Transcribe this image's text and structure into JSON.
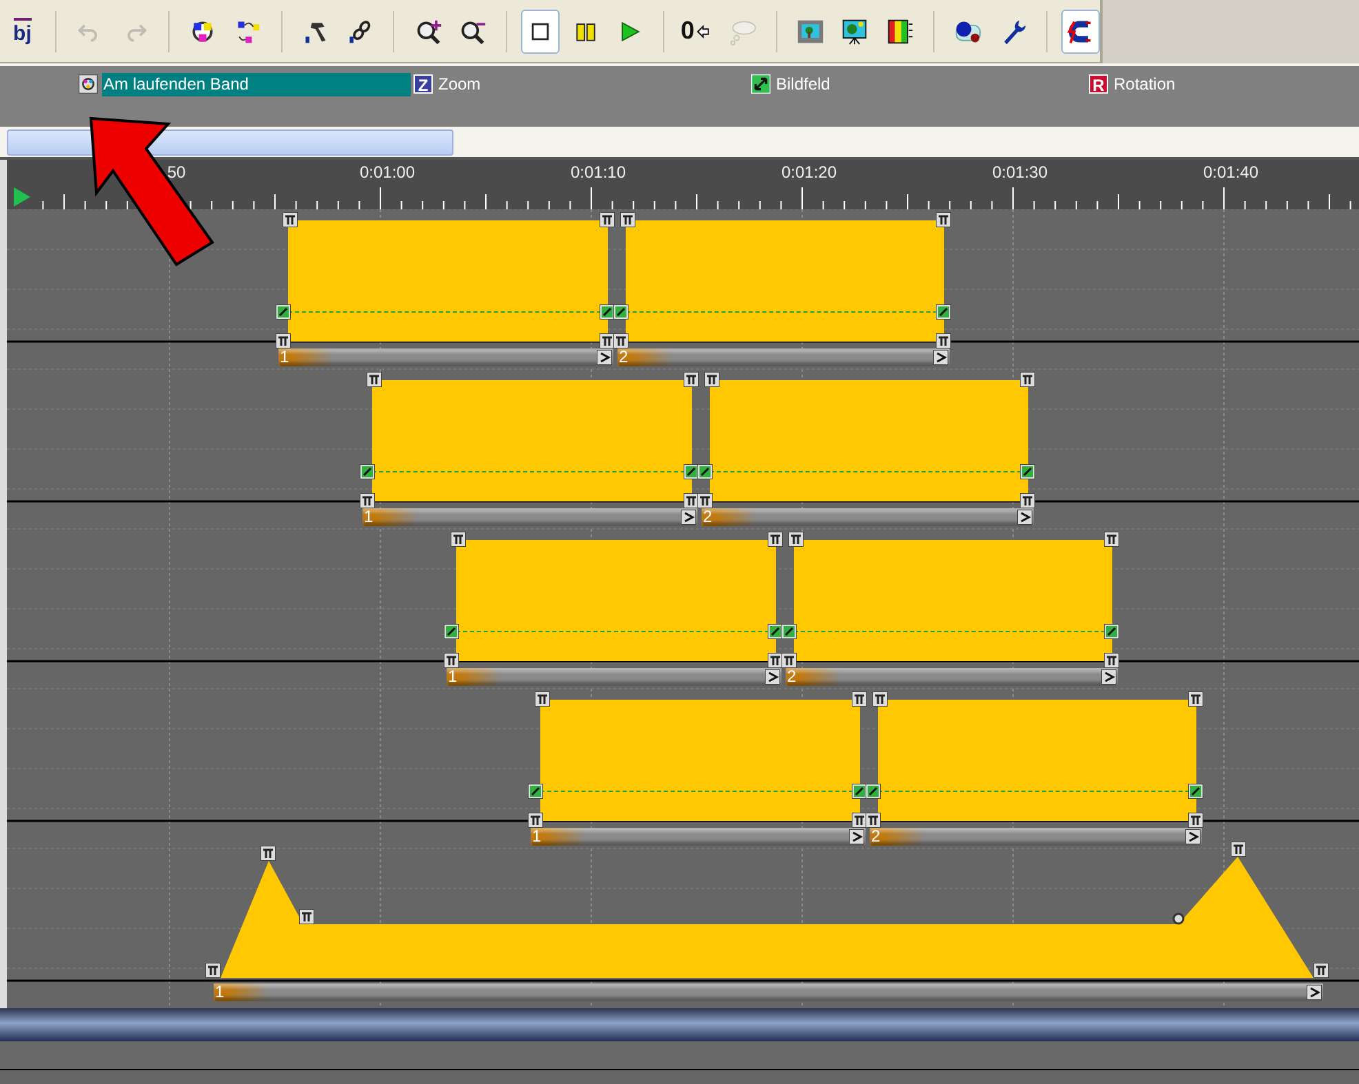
{
  "toolbar_groups": [
    [
      {
        "kind": "obj",
        "label": "bj",
        "pressed": false,
        "disabled": false
      }
    ],
    [
      {
        "kind": "undo",
        "pressed": false,
        "disabled": true
      },
      {
        "kind": "redo",
        "pressed": false,
        "disabled": true
      }
    ],
    [
      {
        "kind": "color-ring",
        "pressed": false,
        "disabled": false
      },
      {
        "kind": "color-path",
        "pressed": false,
        "disabled": false
      }
    ],
    [
      {
        "kind": "hammer",
        "pressed": false,
        "disabled": false
      },
      {
        "kind": "chain",
        "pressed": false,
        "disabled": false
      }
    ],
    [
      {
        "kind": "zoom-in",
        "pressed": false,
        "disabled": false
      },
      {
        "kind": "zoom-out",
        "pressed": false,
        "disabled": false
      }
    ],
    [
      {
        "kind": "stop",
        "pressed": true,
        "disabled": false
      },
      {
        "kind": "pause",
        "pressed": false,
        "disabled": false
      },
      {
        "kind": "play",
        "pressed": false,
        "disabled": false
      }
    ],
    [
      {
        "kind": "rewind",
        "label": "0",
        "pressed": false,
        "disabled": false
      },
      {
        "kind": "sleep",
        "pressed": false,
        "disabled": true
      }
    ],
    [
      {
        "kind": "picture",
        "pressed": false,
        "disabled": false
      },
      {
        "kind": "presentation",
        "pressed": false,
        "disabled": false
      },
      {
        "kind": "meter",
        "pressed": false,
        "disabled": false
      }
    ],
    [
      {
        "kind": "dots",
        "pressed": false,
        "disabled": false
      },
      {
        "kind": "wrench",
        "pressed": false,
        "disabled": false
      }
    ],
    [
      {
        "kind": "magnet",
        "pressed": true,
        "disabled": false
      }
    ]
  ],
  "tracks": [
    {
      "label": "Am laufenden Band",
      "kind": "palette",
      "selected": true
    },
    {
      "label": "Zoom",
      "kind": "letter",
      "letter": "Z",
      "color": "#3b3f9c",
      "selected": false
    },
    {
      "label": "Bildfeld",
      "kind": "arrow",
      "selected": false
    },
    {
      "label": "Rotation",
      "kind": "letter",
      "letter": "R",
      "color": "#c8102e",
      "selected": false
    }
  ],
  "ruler": {
    "labels": [
      "50",
      "0:01:00",
      "0:01:10",
      "0:01:20",
      "0:01:30",
      "0:01:40"
    ]
  },
  "lanes": [
    {
      "clips": [
        {
          "number": "1"
        },
        {
          "number": "2"
        }
      ]
    },
    {
      "clips": [
        {
          "number": "1"
        },
        {
          "number": "2"
        }
      ]
    },
    {
      "clips": [
        {
          "number": "1"
        },
        {
          "number": "2"
        }
      ]
    },
    {
      "clips": [
        {
          "number": "1"
        },
        {
          "number": "2"
        }
      ]
    }
  ],
  "envelope": {
    "number": "1"
  }
}
